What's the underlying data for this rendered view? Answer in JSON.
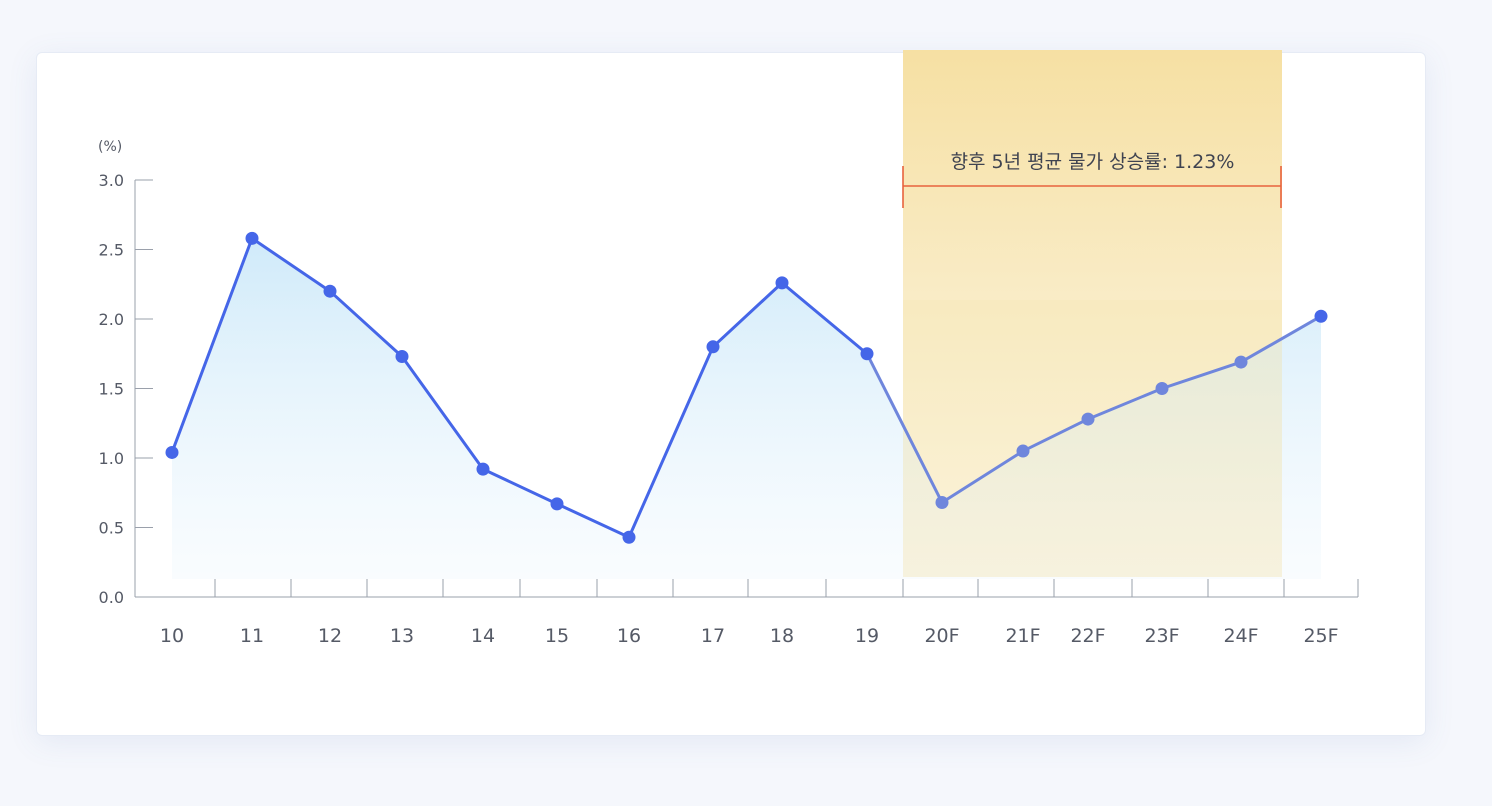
{
  "chart_data": {
    "type": "line",
    "unit_label": "(%)",
    "categories": [
      "10",
      "11",
      "12",
      "13",
      "14",
      "15",
      "16",
      "17",
      "18",
      "19",
      "20F",
      "21F",
      "22F",
      "23F",
      "24F",
      "25F"
    ],
    "values": [
      1.04,
      2.58,
      2.2,
      1.73,
      0.92,
      0.67,
      0.43,
      1.8,
      2.26,
      1.75,
      0.68,
      1.05,
      1.28,
      1.5,
      1.69,
      2.02
    ],
    "ylim": [
      0,
      3.0
    ],
    "yticks": [
      "0.0",
      "0.5",
      "1.0",
      "1.5",
      "2.0",
      "2.5",
      "3.0"
    ],
    "forecast_start_index": 10,
    "annotation": {
      "text": "향후 5년 평균 물가 상승률: 1.23%",
      "from_index": 10,
      "to_index": 14
    },
    "colors": {
      "line": "#4566e8",
      "forecast_line": "#6f86dc",
      "area_top": "#cde9f9",
      "highlight_top": "#f6e0a3",
      "highlight_bottom": "#fdf9ee",
      "bracket": "#e8623d"
    },
    "grid": false,
    "legend": "none"
  }
}
